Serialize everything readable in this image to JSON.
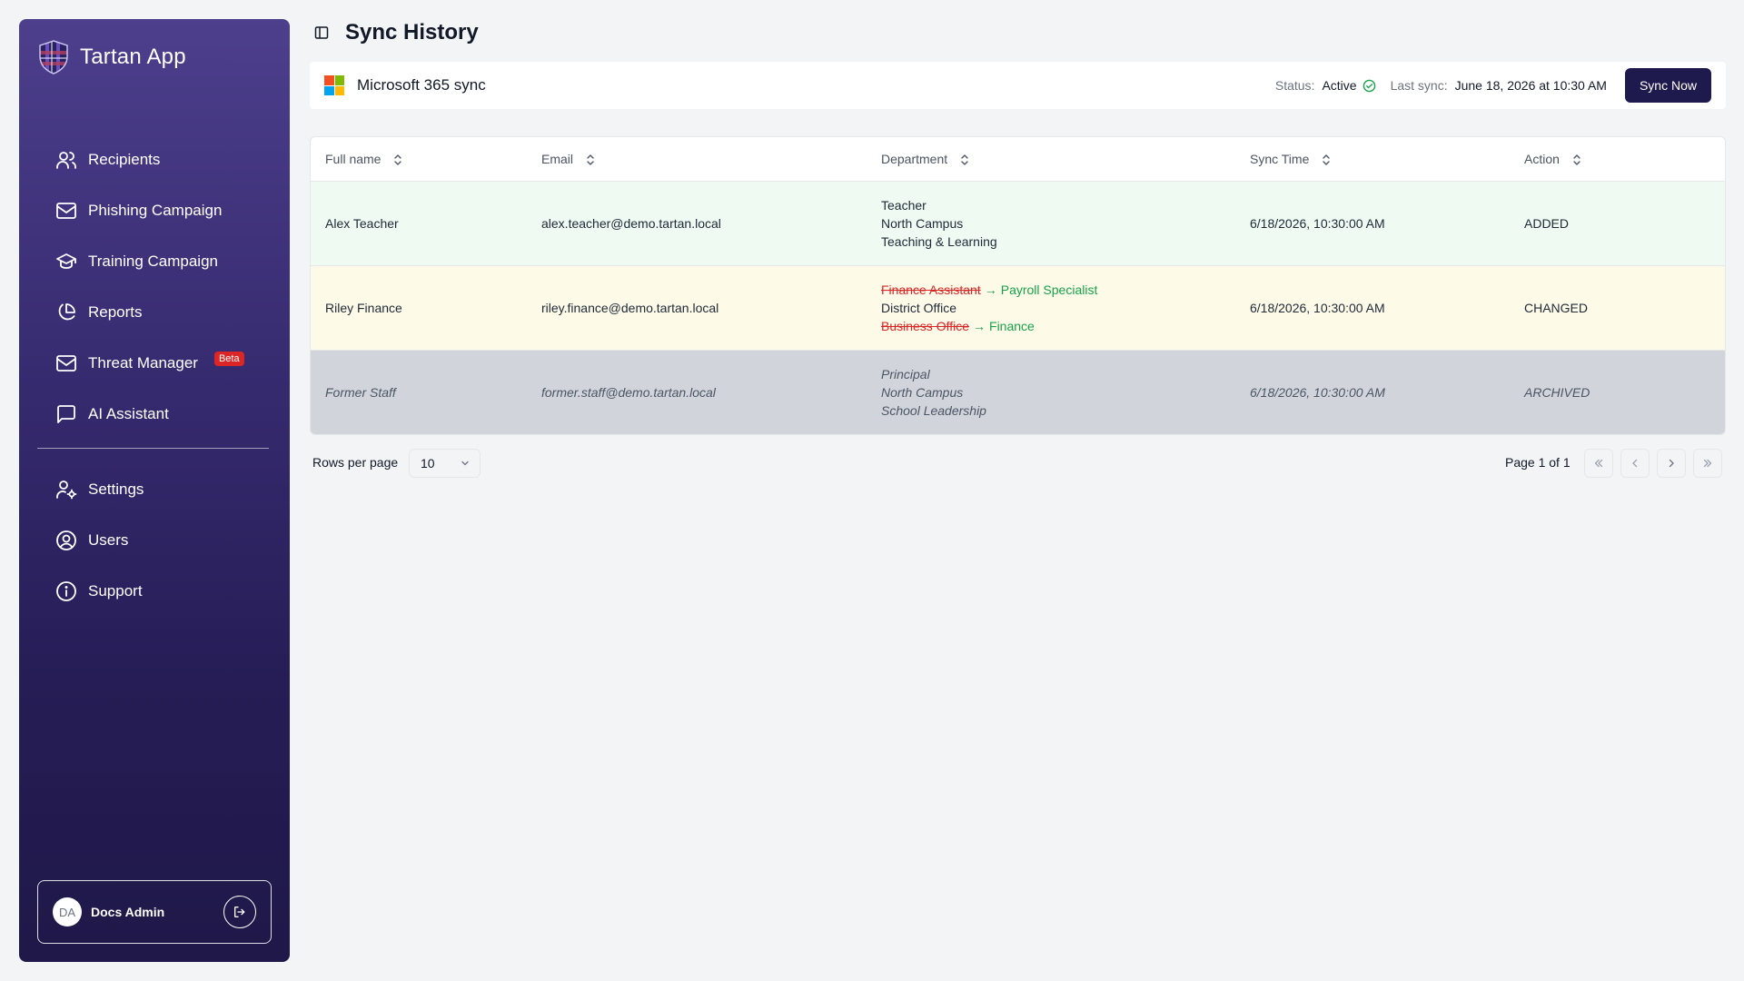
{
  "app": {
    "title": "Tartan App"
  },
  "sidebar": {
    "items": [
      {
        "label": "Recipients",
        "icon": "users-icon"
      },
      {
        "label": "Phishing Campaign",
        "icon": "mail-icon"
      },
      {
        "label": "Training Campaign",
        "icon": "graduation-cap-icon"
      },
      {
        "label": "Reports",
        "icon": "pie-chart-icon"
      },
      {
        "label": "Threat Manager",
        "icon": "mail-icon",
        "badge": "Beta"
      },
      {
        "label": "AI Assistant",
        "icon": "message-square-icon"
      }
    ],
    "secondary_items": [
      {
        "label": "Settings",
        "icon": "user-cog-icon"
      },
      {
        "label": "Users",
        "icon": "user-circle-icon"
      },
      {
        "label": "Support",
        "icon": "info-icon"
      }
    ],
    "user": {
      "initials": "DA",
      "name": "Docs Admin"
    }
  },
  "header": {
    "title": "Sync History"
  },
  "sync": {
    "name": "Microsoft 365 sync",
    "status_label": "Status:",
    "status_value": "Active",
    "last_sync_label": "Last sync:",
    "last_sync_value": "June 18, 2026 at 10:30 AM",
    "button_label": "Sync Now"
  },
  "table": {
    "columns": [
      "Full name",
      "Email",
      "Department",
      "Sync Time",
      "Action"
    ],
    "rows": [
      {
        "full_name": "Alex Teacher",
        "email": "alex.teacher@demo.tartan.local",
        "dept_line1": "Teacher",
        "dept_line2": "North Campus",
        "dept_line3": "Teaching & Learning",
        "sync_time": "6/18/2026, 10:30:00 AM",
        "action": "ADDED"
      },
      {
        "full_name": "Riley Finance",
        "email": "riley.finance@demo.tartan.local",
        "dept_line1_old": "Finance Assistant",
        "dept_line1_new": "Payroll Specialist",
        "dept_line2": "District Office",
        "dept_line3_old": "Business Office",
        "dept_line3_new": "Finance",
        "sync_time": "6/18/2026, 10:30:00 AM",
        "action": "CHANGED"
      },
      {
        "full_name": "Former Staff",
        "email": "former.staff@demo.tartan.local",
        "dept_line1": "Principal",
        "dept_line2": "North Campus",
        "dept_line3": "School Leadership",
        "sync_time": "6/18/2026, 10:30:00 AM",
        "action": "ARCHIVED"
      }
    ]
  },
  "pagination": {
    "rows_per_page_label": "Rows per page",
    "rows_per_page_value": "10",
    "page_label": "Page 1 of 1"
  },
  "colors": {
    "accent": "#1e1a4d",
    "added_row": "#eefaf2",
    "changed_row": "#fdfae8",
    "archived_row": "#d1d5db",
    "removed_text": "#dc2626",
    "new_text": "#16a34a"
  }
}
